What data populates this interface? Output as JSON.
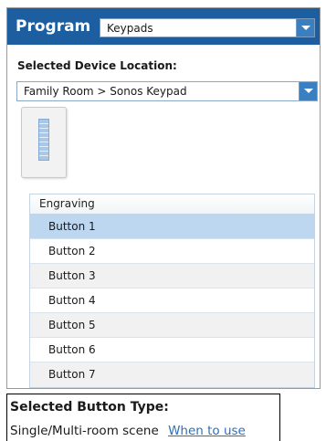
{
  "header": {
    "title": "Program",
    "program_select_value": "Keypads"
  },
  "location": {
    "label": "Selected Device Location:",
    "value": "Family Room > Sonos Keypad"
  },
  "icons": {
    "dropdown": "chevron-down-icon",
    "keypad": "keypad-thumbnail-icon"
  },
  "colors": {
    "header_bg": "#1c5ea0",
    "selected_row": "#bcd7ef",
    "link": "#2f6fb8"
  },
  "engraving_table": {
    "header": "Engraving",
    "rows": [
      {
        "label": "Button 1",
        "selected": true
      },
      {
        "label": "Button 2",
        "selected": false
      },
      {
        "label": "Button 3",
        "selected": false
      },
      {
        "label": "Button 4",
        "selected": false
      },
      {
        "label": "Button 5",
        "selected": false
      },
      {
        "label": "Button 6",
        "selected": false
      },
      {
        "label": "Button 7",
        "selected": false
      }
    ]
  },
  "button_type": {
    "label": "Selected Button Type:",
    "value": "Single/Multi-room scene",
    "help_link": "When to use"
  }
}
